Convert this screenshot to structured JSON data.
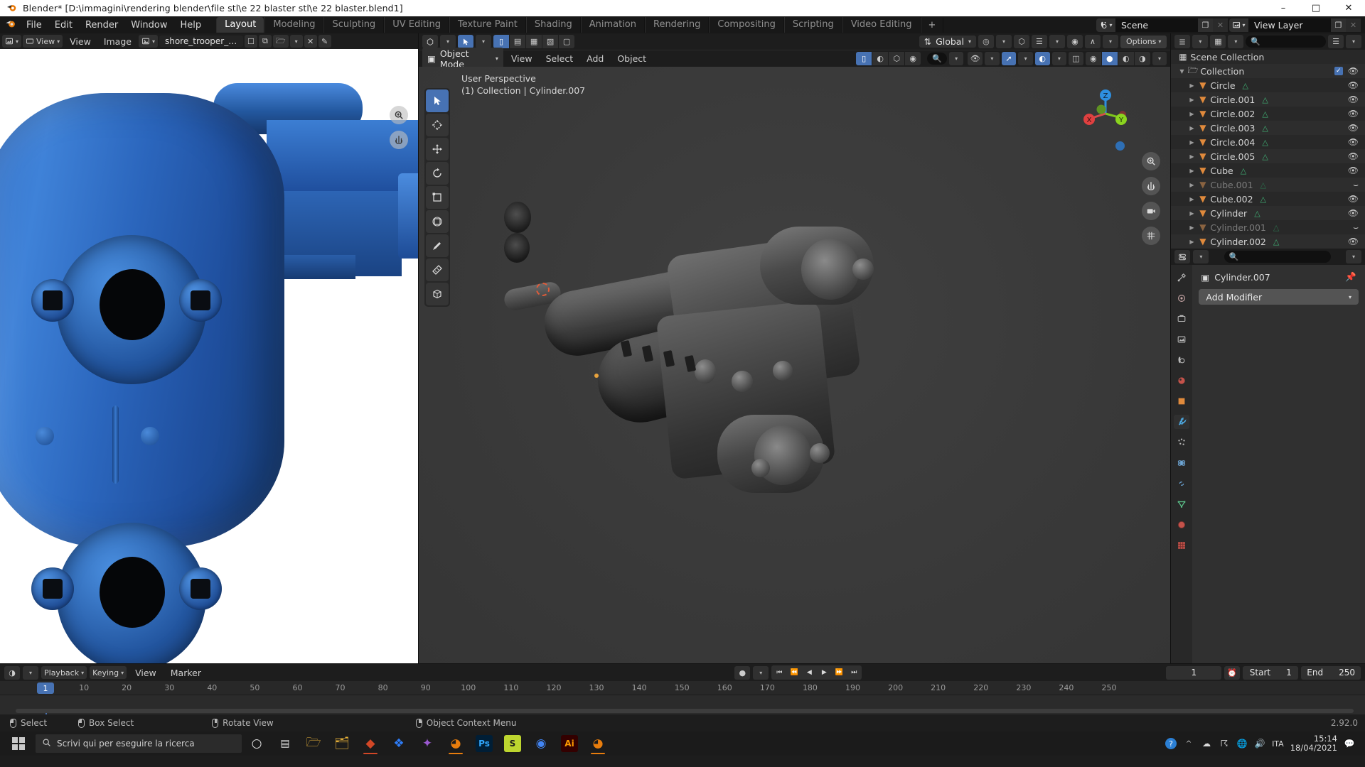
{
  "window": {
    "title": "Blender* [D:\\immagini\\rendering blender\\file stl\\e 22 blaster stl\\e 22 blaster.blend1]",
    "app_icon": "blender-logo-icon",
    "minimize": "–",
    "maximize": "□",
    "close": "✕"
  },
  "topbar": {
    "menus": [
      "File",
      "Edit",
      "Render",
      "Window",
      "Help"
    ],
    "workspaces": [
      {
        "label": "Layout",
        "active": true
      },
      {
        "label": "Modeling",
        "active": false
      },
      {
        "label": "Sculpting",
        "active": false
      },
      {
        "label": "UV Editing",
        "active": false
      },
      {
        "label": "Texture Paint",
        "active": false
      },
      {
        "label": "Shading",
        "active": false
      },
      {
        "label": "Animation",
        "active": false
      },
      {
        "label": "Rendering",
        "active": false
      },
      {
        "label": "Compositing",
        "active": false
      },
      {
        "label": "Scripting",
        "active": false
      },
      {
        "label": "Video Editing",
        "active": false
      }
    ],
    "add_workspace": "+",
    "scene": {
      "label": "Scene",
      "icon": "scene-icon",
      "new_btn": "❐",
      "unlink_btn": "✕"
    },
    "view_layer": {
      "label": "View Layer",
      "icon": "view-layer-icon",
      "new_btn": "❐",
      "unlink_btn": "✕"
    }
  },
  "image_editor": {
    "editor_type_icon": "image-editor-icon",
    "menus": [
      "View",
      "Image"
    ],
    "mode_label": "View",
    "image_name": "shore_trooper_blast...",
    "pin_icon": "pin-icon",
    "new_icon": "new-image-icon",
    "open_icon": "open-image-icon",
    "unlink_icon": "✕",
    "brush_icon": "brush-icon",
    "nav_buttons": [
      "zoom-icon",
      "pan-icon"
    ]
  },
  "viewport": {
    "tool_header": {
      "editor_type_icon": "viewport-icon",
      "select_tool_icon": "tweak-select-icon",
      "snap_magnet_icon": "magnet-icon",
      "proportional_icon": "proportional-edit-icon",
      "transform_orientation": "Global",
      "options_label": "Options"
    },
    "header": {
      "mode": "Object Mode",
      "menus": [
        "View",
        "Select",
        "Add",
        "Object"
      ],
      "shading_modes": [
        "wireframe",
        "solid",
        "material-preview",
        "rendered"
      ],
      "active_shading": "solid"
    },
    "overlay_text_line1": "User Perspective",
    "overlay_text_line2": "(1) Collection | Cylinder.007",
    "gizmo_axes": [
      "Z",
      "Y",
      "X"
    ],
    "toolbar_tools": [
      "tweak-select-tool",
      "cursor-tool",
      "move-tool",
      "rotate-tool",
      "scale-tool",
      "transform-tool",
      "annotate-tool",
      "measure-tool",
      "add-cube-tool"
    ],
    "nav_buttons": [
      "zoom-icon",
      "pan-icon",
      "camera-icon",
      "grid-icon"
    ]
  },
  "outliner": {
    "editor_icon": "outliner-icon",
    "display_mode": "View Layer",
    "search_placeholder": "",
    "filter_icon": "filter-icon",
    "root": "Scene Collection",
    "collection": {
      "label": "Collection",
      "checked": true,
      "visible": true
    },
    "items": [
      {
        "label": "Circle",
        "type": "mesh",
        "hidden": false
      },
      {
        "label": "Circle.001",
        "type": "mesh",
        "hidden": false
      },
      {
        "label": "Circle.002",
        "type": "mesh",
        "hidden": false
      },
      {
        "label": "Circle.003",
        "type": "mesh",
        "hidden": false
      },
      {
        "label": "Circle.004",
        "type": "mesh",
        "hidden": false
      },
      {
        "label": "Circle.005",
        "type": "mesh",
        "hidden": false
      },
      {
        "label": "Cube",
        "type": "mesh",
        "hidden": false
      },
      {
        "label": "Cube.001",
        "type": "mesh",
        "hidden": true
      },
      {
        "label": "Cube.002",
        "type": "mesh",
        "hidden": false
      },
      {
        "label": "Cylinder",
        "type": "mesh",
        "hidden": false
      },
      {
        "label": "Cylinder.001",
        "type": "mesh",
        "hidden": true
      },
      {
        "label": "Cylinder.002",
        "type": "mesh",
        "hidden": false
      }
    ]
  },
  "properties": {
    "editor_icon": "properties-icon",
    "search_placeholder": "",
    "breadcrumb_object": "Cylinder.007",
    "object_icon": "object-data-icon",
    "pin_icon": "pin-icon",
    "add_modifier": "Add Modifier",
    "tabs": [
      {
        "name": "tool-tab",
        "icon": "⚒",
        "active": false
      },
      {
        "name": "render-tab",
        "icon": "▣",
        "active": false
      },
      {
        "name": "output-tab",
        "icon": "⎙",
        "active": false
      },
      {
        "name": "view-layer-tab",
        "icon": "❐",
        "active": false
      },
      {
        "name": "scene-tab",
        "icon": "◎",
        "active": false
      },
      {
        "name": "world-tab",
        "icon": "●",
        "active": false
      },
      {
        "name": "object-tab",
        "icon": "□",
        "active": false
      },
      {
        "name": "modifier-tab",
        "icon": "🔧",
        "active": true
      },
      {
        "name": "particles-tab",
        "icon": "⁂",
        "active": false
      },
      {
        "name": "physics-tab",
        "icon": "⟳",
        "active": false
      },
      {
        "name": "constraints-tab",
        "icon": "⛓",
        "active": false
      },
      {
        "name": "object-data-tab",
        "icon": "▽",
        "active": false
      },
      {
        "name": "material-tab",
        "icon": "●",
        "active": false
      },
      {
        "name": "texture-tab",
        "icon": "▒",
        "active": false
      }
    ]
  },
  "timeline": {
    "editor_icon": "timeline-icon",
    "menus": [
      "Playback",
      "Keying",
      "View",
      "Marker"
    ],
    "auto_key_icon": "record-icon",
    "transport": [
      "jump-start",
      "prev-keyframe",
      "play-reverse",
      "play",
      "next-keyframe",
      "jump-end"
    ],
    "current_frame": "1",
    "start_label": "Start",
    "start_value": "1",
    "end_label": "End",
    "end_value": "250",
    "ticks": [
      10,
      20,
      30,
      40,
      50,
      60,
      70,
      80,
      90,
      100,
      110,
      120,
      130,
      140,
      150,
      160,
      170,
      180,
      190,
      200,
      210,
      220,
      230,
      240,
      250
    ],
    "playhead_frame": "1"
  },
  "statusbar": {
    "items": [
      {
        "icon": "mouse-left-icon",
        "label": "Select"
      },
      {
        "icon": "mouse-drag-icon",
        "label": "Box Select"
      },
      {
        "icon": "mouse-middle-icon",
        "label": "Rotate View"
      },
      {
        "icon": "mouse-right-icon",
        "label": "Object Context Menu"
      }
    ],
    "version": "2.92.0"
  },
  "taskbar": {
    "start_icon": "windows-start-icon",
    "search_placeholder": "Scrivi qui per eseguire la ricerca",
    "search_icon": "search-icon",
    "pinned": [
      {
        "name": "cortana-icon",
        "glyph": "○",
        "color": "#e0e0e0",
        "accent": ""
      },
      {
        "name": "task-view-icon",
        "glyph": "☰",
        "color": "#e0e0e0",
        "accent": ""
      },
      {
        "name": "file-explorer-icon",
        "glyph": "🗀",
        "color": "#e8b23a",
        "accent": ""
      },
      {
        "name": "folder-icon",
        "glyph": "🗂",
        "color": "#e8b23a",
        "accent": ""
      },
      {
        "name": "powerpoint-icon",
        "glyph": "◆",
        "color": "#d24726",
        "accent": "#d24726"
      },
      {
        "name": "dropbox-icon",
        "glyph": "❖",
        "color": "#2e7cf6",
        "accent": ""
      },
      {
        "name": "krita-icon",
        "glyph": "✦",
        "color": "#9b59d0",
        "accent": ""
      },
      {
        "name": "blender-icon",
        "glyph": "◑",
        "color": "#e87d0d",
        "accent": "#e87d0d"
      },
      {
        "name": "photoshop-icon",
        "glyph": "Ps",
        "color": "#31a8ff",
        "accent": "#31a8ff"
      },
      {
        "name": "substance-icon",
        "glyph": "S",
        "color": "#bdd52f",
        "accent": ""
      },
      {
        "name": "chrome-icon",
        "glyph": "◉",
        "color": "#4285f4",
        "accent": ""
      },
      {
        "name": "illustrator-icon",
        "glyph": "Ai",
        "color": "#ff9a00",
        "accent": ""
      },
      {
        "name": "blender2-icon",
        "glyph": "◑",
        "color": "#e87d0d",
        "accent": "#e87d0d"
      }
    ],
    "tray": [
      {
        "name": "help-circle-icon",
        "glyph": "?"
      },
      {
        "name": "show-hidden-icon",
        "glyph": "∧"
      },
      {
        "name": "onedrive-icon",
        "glyph": "☁"
      },
      {
        "name": "usb-icon",
        "glyph": "⚡"
      },
      {
        "name": "network-icon",
        "glyph": "🌐"
      },
      {
        "name": "volume-icon",
        "glyph": "🔊"
      },
      {
        "name": "language-icon",
        "glyph": "ITA"
      }
    ],
    "time": "15:14",
    "date": "18/04/2021",
    "notification_icon": "notification-icon"
  }
}
